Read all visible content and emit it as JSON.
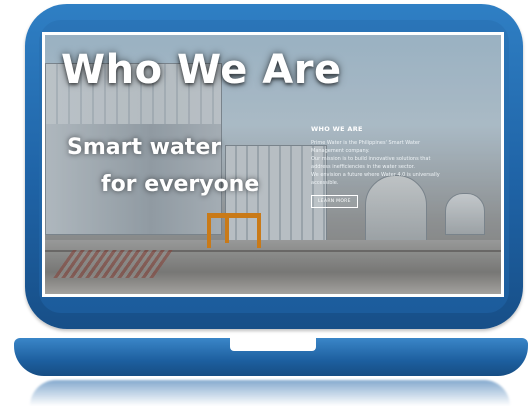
{
  "hero": {
    "headline": "Who We Are",
    "tagline_line1": "Smart water",
    "tagline_line2": "for everyone"
  },
  "about_panel": {
    "title": "WHO WE ARE",
    "paragraph1": "Prime Water is the Philippines' Smart Water Management company.",
    "paragraph2": "Our mission is to build innovative solutions that address inefficiencies in the water sector.",
    "paragraph3": "We envision a future where Water 4.0 is universally accessible.",
    "button_label": "LEARN MORE"
  },
  "colors": {
    "frame_blue": "#1f63a6",
    "crane_orange": "#f08b10"
  }
}
